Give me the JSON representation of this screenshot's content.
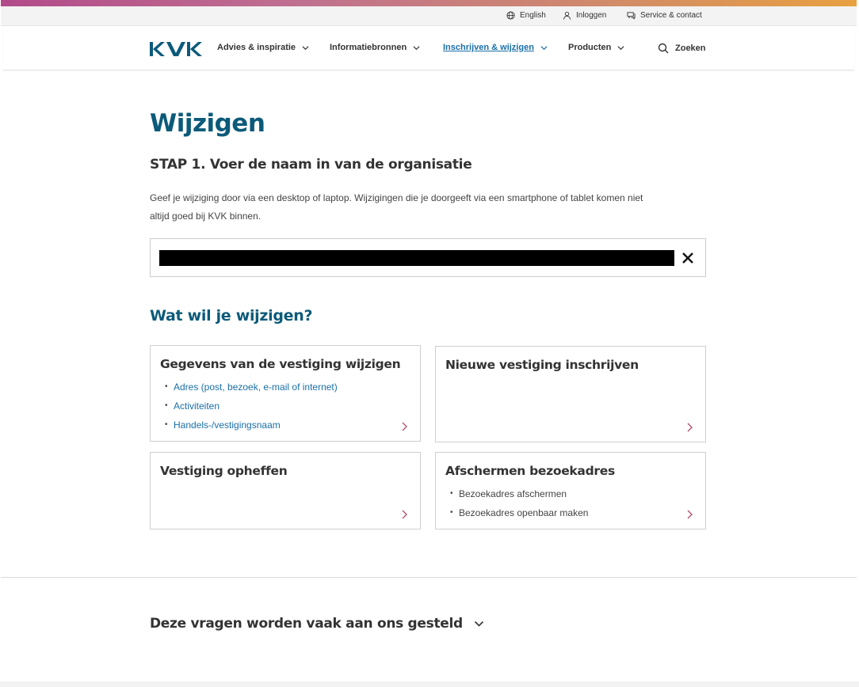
{
  "colors": {
    "brand": "#0c5a7a",
    "link": "#1a6fa8",
    "gradient_start": "#b24a8a",
    "gradient_end": "#e8a040"
  },
  "utility": {
    "language": {
      "label": "English",
      "icon": "globe-icon"
    },
    "login": {
      "label": "Inloggen",
      "icon": "user-icon"
    },
    "service": {
      "label": "Service & contact",
      "icon": "chat-icon"
    }
  },
  "nav": {
    "logo_text": "KVK",
    "items": [
      {
        "label": "Advies & inspiratie"
      },
      {
        "label": "Informatiebronnen"
      },
      {
        "label": "Inschrijven & wijzigen",
        "active": true
      },
      {
        "label": "Producten"
      }
    ],
    "search": {
      "label": "Zoeken",
      "icon": "search-icon"
    }
  },
  "page": {
    "title": "Wijzigen",
    "step_title": "STAP 1. Voer de naam in van de organisatie",
    "intro": "Geef je wijziging door via een desktop of laptop. Wijzigingen die je doorgeeft via een smartphone of tablet komen niet altijd goed bij KVK binnen.",
    "name_field": {
      "value": "",
      "clear_icon": "close-icon"
    },
    "section_title": "Wat wil je wijzigen?"
  },
  "cards": [
    {
      "title": "Gegevens van de vestiging wijzigen",
      "items": [
        "Adres (post, bezoek, e-mail of internet)",
        "Activiteiten",
        "Handels-/vestigingsnaam"
      ]
    },
    {
      "title": "Nieuwe vestiging inschrijven",
      "items": []
    },
    {
      "title": "Vestiging opheffen",
      "items": []
    },
    {
      "title": "Afschermen bezoekadres",
      "items": [
        "Bezoekadres afschermen",
        "Bezoekadres openbaar maken"
      ]
    }
  ],
  "faq": {
    "title": "Deze vragen worden vaak aan ons gesteld"
  }
}
